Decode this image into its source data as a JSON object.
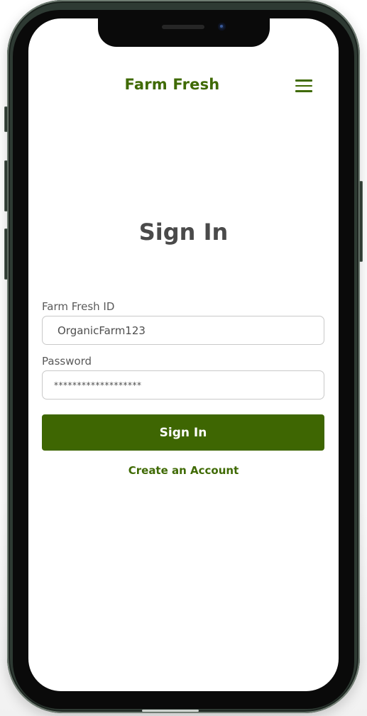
{
  "header": {
    "brand_title": "Farm Fresh",
    "menu_icon": "hamburger-menu-icon"
  },
  "main": {
    "page_title": "Sign In",
    "id_field": {
      "label": "Farm Fresh ID",
      "value": "OrganicFarm123"
    },
    "password_field": {
      "label": "Password",
      "value": "*******************"
    },
    "sign_in_button_label": "Sign In",
    "create_account_link": "Create an Account"
  },
  "colors": {
    "brand_green": "#3f6a03",
    "button_green": "#3e6602",
    "title_gray": "#4a4a4a",
    "phone_frame": "#2e3a33"
  }
}
